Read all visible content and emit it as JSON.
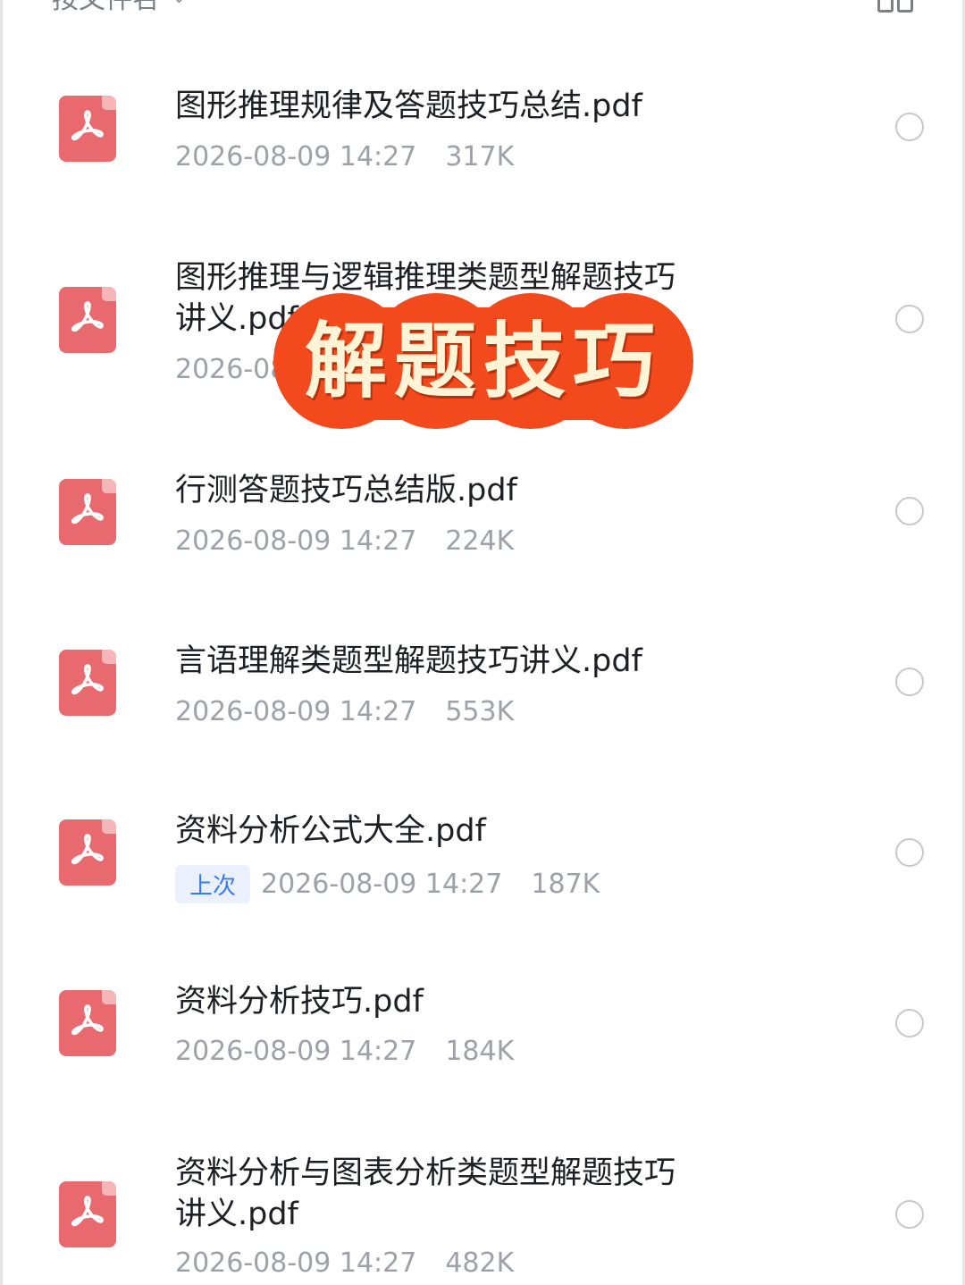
{
  "header": {
    "sort_label": "按文件名",
    "sort_caret": "⌄",
    "view_icon": "grid-view-icon"
  },
  "colors": {
    "pdf_icon": "#e96a6e",
    "banner": "#f24a1d",
    "banner_text": "#fff4d6",
    "recent_tag_text": "#3a7af2",
    "recent_tag_bg": "#eaf1fd"
  },
  "files": [
    {
      "name": "图形推理规律及答题技巧总结.pdf",
      "date": "2026-08-09 14:27",
      "size": "317K",
      "tag": ""
    },
    {
      "name": "图形推理与逻辑推理类题型解题技巧\n讲义.pdf",
      "date": "2026-08-09 14:27",
      "size": "",
      "tag": ""
    },
    {
      "name": "行测答题技巧总结版.pdf",
      "date": "2026-08-09 14:27",
      "size": "224K",
      "tag": ""
    },
    {
      "name": "言语理解类题型解题技巧讲义.pdf",
      "date": "2026-08-09 14:27",
      "size": "553K",
      "tag": ""
    },
    {
      "name": "资料分析公式大全.pdf",
      "date": "2026-08-09 14:27",
      "size": "187K",
      "tag": "上次"
    },
    {
      "name": "资料分析技巧.pdf",
      "date": "2026-08-09 14:27",
      "size": "184K",
      "tag": ""
    },
    {
      "name": "资料分析与图表分析类题型解题技巧\n讲义.pdf",
      "date": "2026-08-09 14:27",
      "size": "482K",
      "tag": ""
    }
  ],
  "overlay": {
    "text": "解题技巧"
  }
}
